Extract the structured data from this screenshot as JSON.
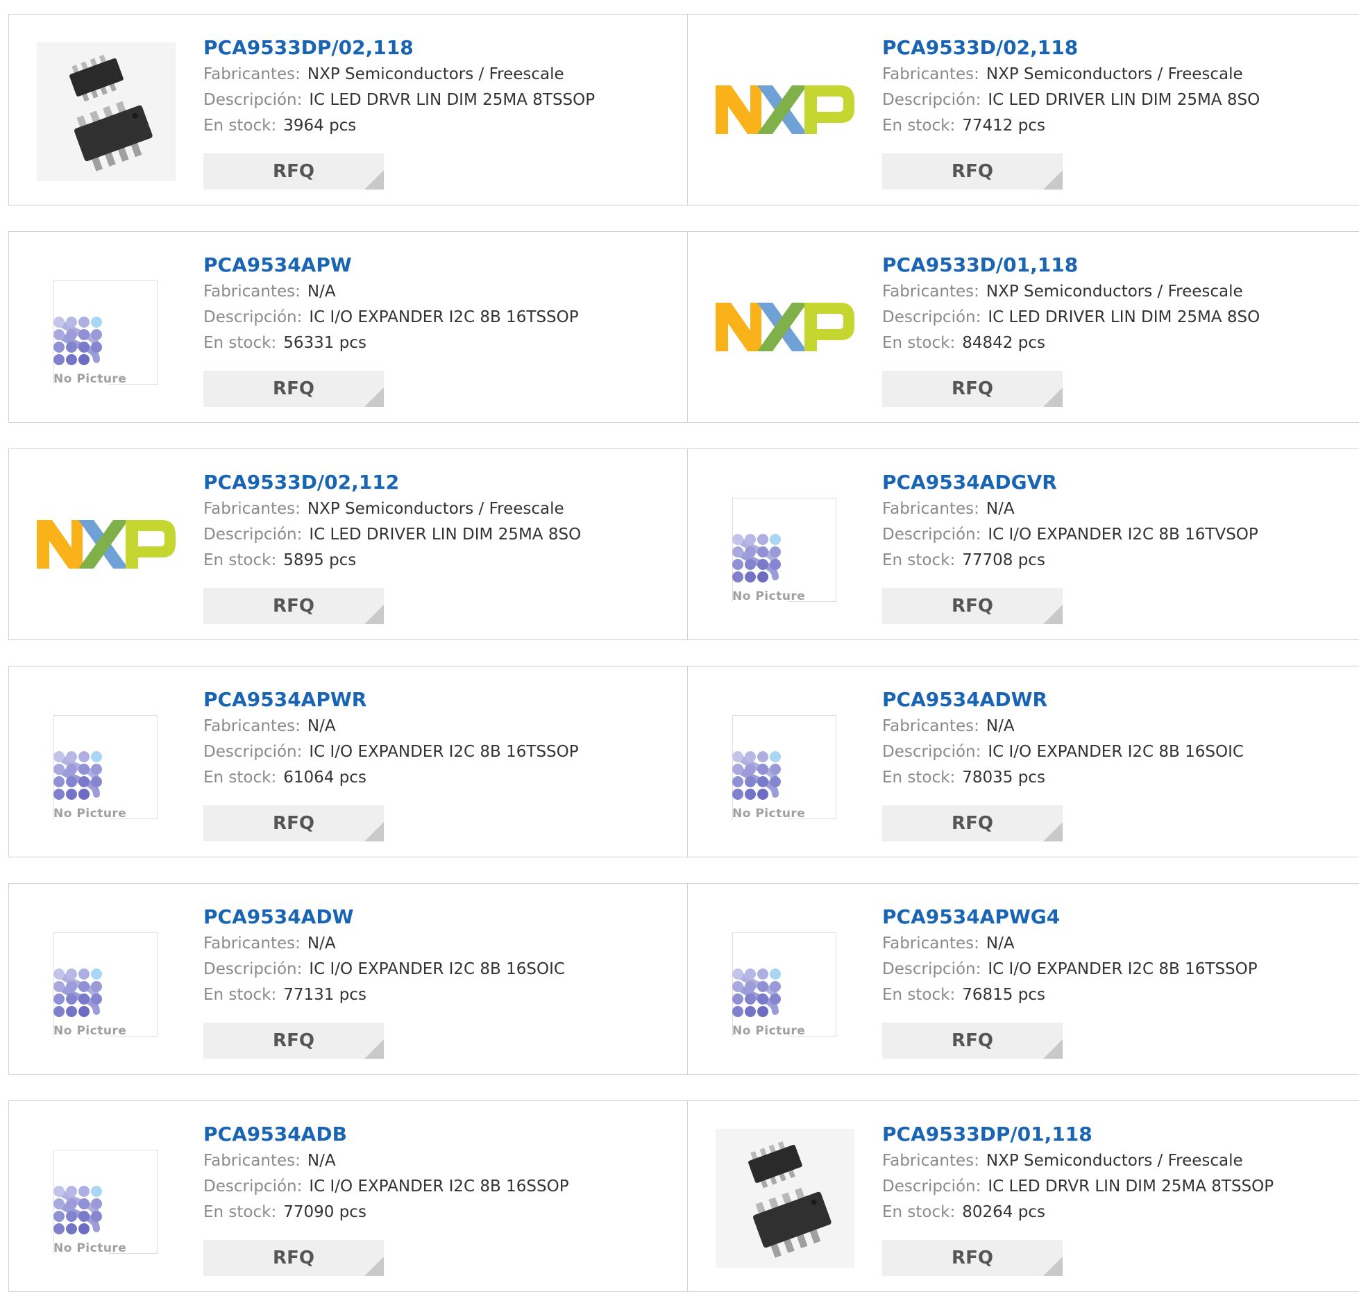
{
  "labels": {
    "fabricantes": "Fabricantes:",
    "descripcion": "Descripción:",
    "en_stock": "En stock:",
    "rfq": "RFQ",
    "no_picture": "No Picture",
    "nxp_logo": "NXP"
  },
  "colors": {
    "link": "#1a64b4",
    "nxp_orange": "#f9b21a",
    "nxp_blue": "#6fa1d6",
    "nxp_green": "#c6d631",
    "nopic_dots": "#8f8fd6"
  },
  "products": [
    {
      "part": "PCA9533DP/02,118",
      "manufacturer": "NXP Semiconductors / Freescale",
      "description": "IC LED DRVR LIN DIM 25MA 8TSSOP",
      "stock": "3964 pcs",
      "image": "chip-photo"
    },
    {
      "part": "PCA9533D/02,118",
      "manufacturer": "NXP Semiconductors / Freescale",
      "description": "IC LED DRIVER LIN DIM 25MA 8SO",
      "stock": "77412 pcs",
      "image": "nxp-logo"
    },
    {
      "part": "PCA9534APW",
      "manufacturer": "N/A",
      "description": "IC I/O EXPANDER I2C 8B 16TSSOP",
      "stock": "56331 pcs",
      "image": "no-picture"
    },
    {
      "part": "PCA9533D/01,118",
      "manufacturer": "NXP Semiconductors / Freescale",
      "description": "IC LED DRIVER LIN DIM 25MA 8SO",
      "stock": "84842 pcs",
      "image": "nxp-logo"
    },
    {
      "part": "PCA9533D/02,112",
      "manufacturer": "NXP Semiconductors / Freescale",
      "description": "IC LED DRIVER LIN DIM 25MA 8SO",
      "stock": "5895 pcs",
      "image": "nxp-logo"
    },
    {
      "part": "PCA9534ADGVR",
      "manufacturer": "N/A",
      "description": "IC I/O EXPANDER I2C 8B 16TVSOP",
      "stock": "77708 pcs",
      "image": "no-picture"
    },
    {
      "part": "PCA9534APWR",
      "manufacturer": "N/A",
      "description": "IC I/O EXPANDER I2C 8B 16TSSOP",
      "stock": "61064 pcs",
      "image": "no-picture"
    },
    {
      "part": "PCA9534ADWR",
      "manufacturer": "N/A",
      "description": "IC I/O EXPANDER I2C 8B 16SOIC",
      "stock": "78035 pcs",
      "image": "no-picture"
    },
    {
      "part": "PCA9534ADW",
      "manufacturer": "N/A",
      "description": "IC I/O EXPANDER I2C 8B 16SOIC",
      "stock": "77131 pcs",
      "image": "no-picture"
    },
    {
      "part": "PCA9534APWG4",
      "manufacturer": "N/A",
      "description": "IC I/O EXPANDER I2C 8B 16TSSOP",
      "stock": "76815 pcs",
      "image": "no-picture"
    },
    {
      "part": "PCA9534ADB",
      "manufacturer": "N/A",
      "description": "IC I/O EXPANDER I2C 8B 16SSOP",
      "stock": "77090 pcs",
      "image": "no-picture"
    },
    {
      "part": "PCA9533DP/01,118",
      "manufacturer": "NXP Semiconductors / Freescale",
      "description": "IC LED DRVR LIN DIM 25MA 8TSSOP",
      "stock": "80264 pcs",
      "image": "chip-photo"
    }
  ]
}
